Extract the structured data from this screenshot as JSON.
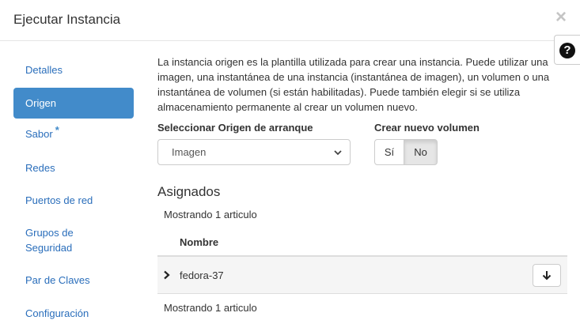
{
  "modal": {
    "title": "Ejecutar Instancia",
    "close_label": "×",
    "help_label": "?"
  },
  "sidebar": {
    "items": [
      {
        "label": "Detalles",
        "active": false
      },
      {
        "label": "Origen",
        "active": true
      },
      {
        "label": "Sabor",
        "required": "*"
      },
      {
        "label": "Redes"
      },
      {
        "label": "Puertos de red"
      },
      {
        "label": "Grupos de Seguridad"
      },
      {
        "label": "Par de Claves"
      },
      {
        "label": "Configuración"
      }
    ]
  },
  "content": {
    "intro": "La instancia origen es la plantilla utilizada para crear una instancia. Puede utilizar una imagen, una instantánea de una instancia (instantánea de imagen), un volumen o una instantánea de volumen (si están habilitadas). Puede también elegir si se utiliza almacenamiento permanente al crear un volumen nuevo.",
    "boot_source": {
      "label": "Seleccionar Origen de arranque",
      "value": "Imagen"
    },
    "new_volume": {
      "label": "Crear nuevo volumen",
      "options": [
        "Sí",
        "No"
      ],
      "selected": "No"
    },
    "allocated": {
      "title": "Asignados",
      "count_text": "Mostrando 1 articulo",
      "columns": [
        "Nombre"
      ],
      "rows": [
        {
          "name": "fedora-37"
        }
      ],
      "footer_count_text": "Mostrando 1 articulo"
    }
  },
  "colors": {
    "accent": "#428bca",
    "link": "#2a6ebb"
  },
  "icons": [
    "close-icon",
    "help-icon",
    "chevron-down-icon",
    "chevron-right-icon",
    "arrow-down-icon"
  ]
}
